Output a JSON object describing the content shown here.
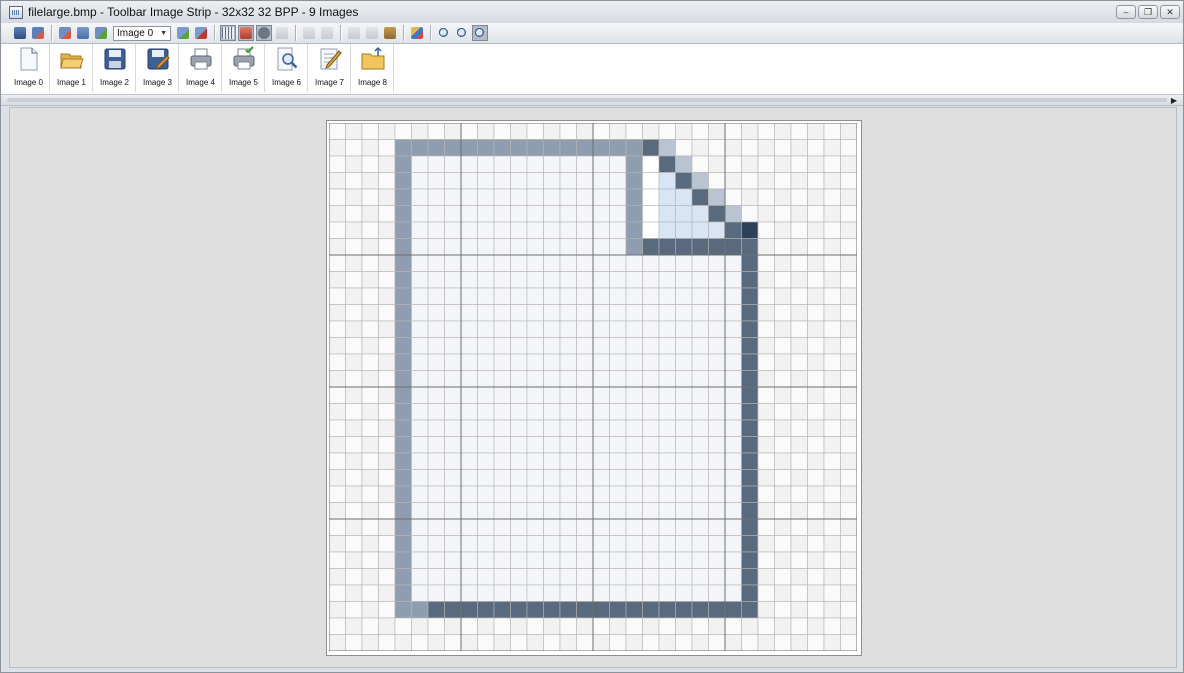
{
  "window": {
    "title": "filelarge.bmp - Toolbar Image Strip - 32x32 32 BPP - 9 Images",
    "controls": [
      "minimize",
      "restore",
      "close"
    ]
  },
  "toolbar": {
    "image_select": {
      "selected": "Image 0"
    },
    "buttons": [
      {
        "name": "save-button",
        "icon": "save-icon"
      },
      {
        "name": "save-as-button",
        "icon": "save-as-icon"
      },
      {
        "name": "add-image-button",
        "icon": "add-image-icon"
      },
      {
        "name": "copy-image-button",
        "icon": "copy-image-icon"
      },
      {
        "name": "refresh-button",
        "icon": "refresh-icon"
      },
      {
        "name": "insert-image-button",
        "icon": "insert-image-icon"
      },
      {
        "name": "delete-image-button",
        "icon": "delete-image-icon"
      },
      {
        "name": "toggle-grid-button",
        "icon": "grid-icon",
        "state": "pressed"
      },
      {
        "name": "transparency-button",
        "icon": "transparency-icon",
        "state": "pressed"
      },
      {
        "name": "no-transparency-button",
        "icon": "no-entry-icon",
        "state": "pressed"
      },
      {
        "name": "print-button",
        "icon": "print-icon",
        "state": "disabled"
      },
      {
        "name": "undo-button",
        "icon": "undo-icon",
        "state": "disabled"
      },
      {
        "name": "redo-button",
        "icon": "redo-icon",
        "state": "disabled"
      },
      {
        "name": "cut-button",
        "icon": "cut-icon",
        "state": "disabled"
      },
      {
        "name": "copy-button",
        "icon": "copy-icon",
        "state": "disabled"
      },
      {
        "name": "paste-button",
        "icon": "paste-icon"
      },
      {
        "name": "import-image-button",
        "icon": "image-icon"
      },
      {
        "name": "zoom-in-button",
        "icon": "zoom-in-icon"
      },
      {
        "name": "zoom-out-button",
        "icon": "zoom-out-icon"
      },
      {
        "name": "zoom-fit-button",
        "icon": "zoom-fit-icon",
        "state": "pressed"
      }
    ]
  },
  "strip": {
    "items": [
      {
        "label": "Image 0",
        "icon": "new-file-icon"
      },
      {
        "label": "Image 1",
        "icon": "open-folder-icon"
      },
      {
        "label": "Image 2",
        "icon": "floppy-disk-icon"
      },
      {
        "label": "Image 3",
        "icon": "save-as-disk-icon"
      },
      {
        "label": "Image 4",
        "icon": "printer-icon"
      },
      {
        "label": "Image 5",
        "icon": "printer-check-icon"
      },
      {
        "label": "Image 6",
        "icon": "print-preview-icon"
      },
      {
        "label": "Image 7",
        "icon": "edit-document-icon"
      },
      {
        "label": "Image 8",
        "icon": "folder-up-icon"
      }
    ]
  },
  "colors": {
    "border_light": "#8f9db0",
    "border_dark": "#5a6a7e",
    "page_fill": "#f3f5f9",
    "fold_light": "#d9e4f5",
    "fold_dark": "#2e4058"
  }
}
